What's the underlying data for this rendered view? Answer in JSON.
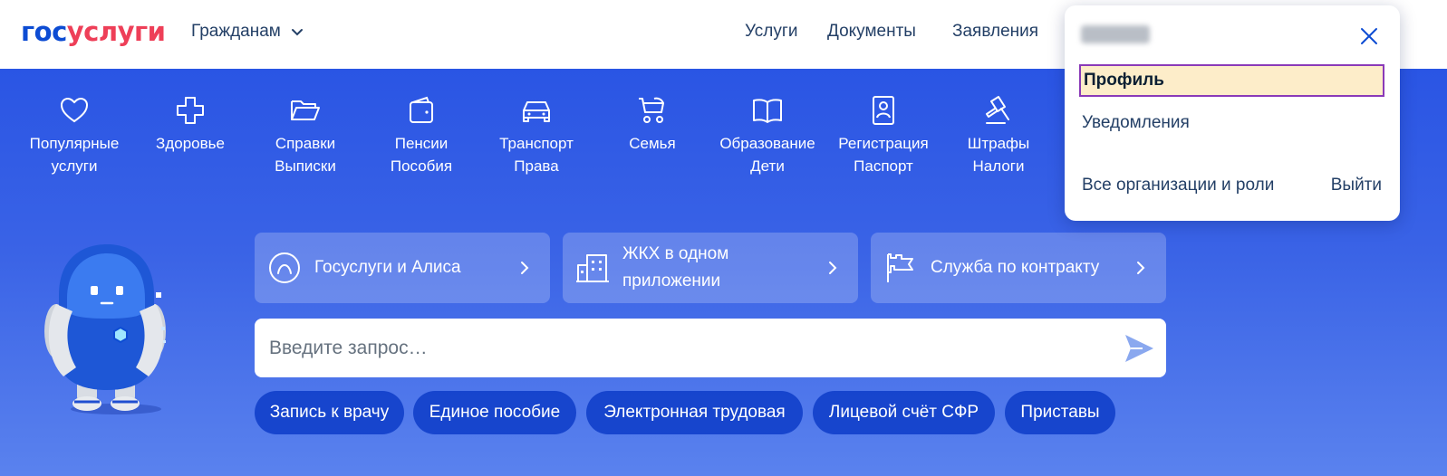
{
  "header": {
    "logo_part1": "гос",
    "logo_part2": "услуги",
    "audience": "Гражданам",
    "nav": [
      "Услуги",
      "Документы",
      "Заявления"
    ]
  },
  "categories": [
    {
      "line1": "Популярные",
      "line2": "услуги",
      "icon": "heart-icon"
    },
    {
      "line1": "Здоровье",
      "line2": "",
      "icon": "medical-cross-icon"
    },
    {
      "line1": "Справки",
      "line2": "Выписки",
      "icon": "folder-icon"
    },
    {
      "line1": "Пенсии",
      "line2": "Пособия",
      "icon": "wallet-icon"
    },
    {
      "line1": "Транспорт",
      "line2": "Права",
      "icon": "car-icon"
    },
    {
      "line1": "Семья",
      "line2": "",
      "icon": "stroller-icon"
    },
    {
      "line1": "Образование",
      "line2": "Дети",
      "icon": "book-icon"
    },
    {
      "line1": "Регистрация",
      "line2": "Паспорт",
      "icon": "passport-icon"
    },
    {
      "line1": "Штрафы",
      "line2": "Налоги",
      "icon": "gavel-icon"
    }
  ],
  "promos": [
    {
      "text": "Госуслуги и Алиса",
      "icon": "alice-icon"
    },
    {
      "text": "ЖКХ в одном приложении",
      "icon": "building-icon"
    },
    {
      "text": "Служба по контракту",
      "icon": "flag-icon"
    }
  ],
  "search": {
    "placeholder": "Введите запрос…"
  },
  "chips": [
    "Запись к врачу",
    "Единое пособие",
    "Электронная трудовая",
    "Лицевой счёт СФР",
    "Приставы"
  ],
  "dropdown": {
    "profile": "Профиль",
    "notifications": "Уведомления",
    "organizations": "Все организации и роли",
    "logout": "Выйти"
  }
}
